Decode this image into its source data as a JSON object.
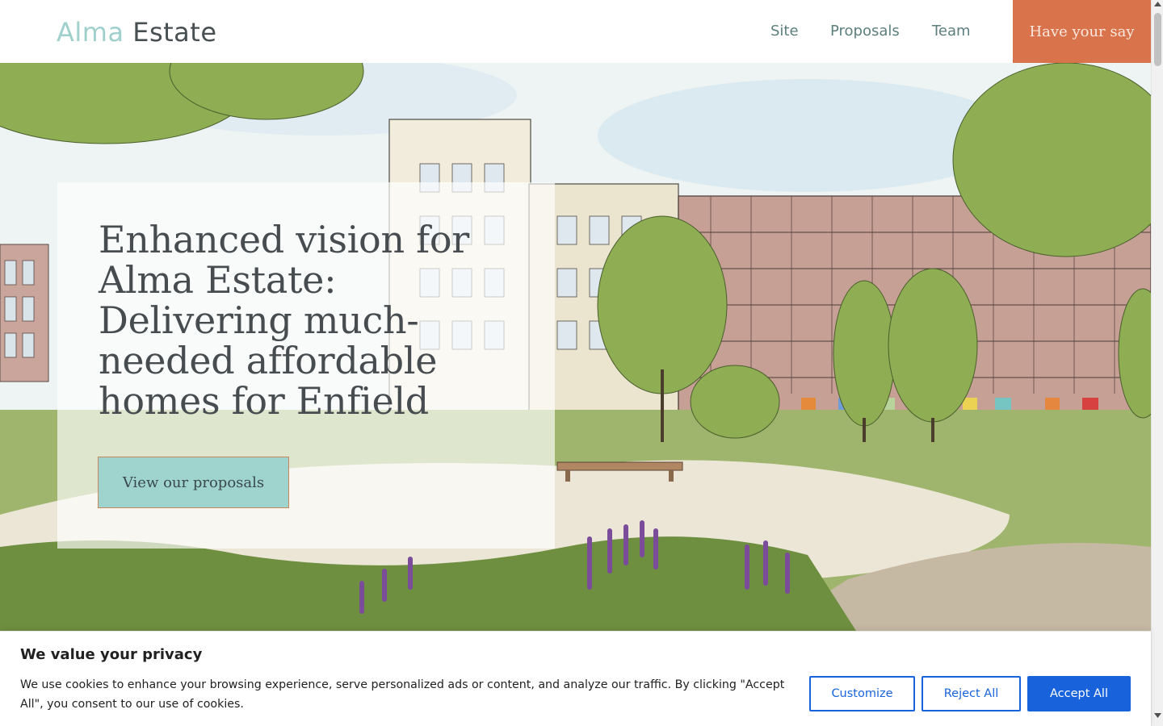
{
  "header": {
    "logo_part1": "Alma",
    "logo_part2": "Estate",
    "nav": [
      {
        "label": "Site"
      },
      {
        "label": "Proposals"
      },
      {
        "label": "Team"
      }
    ],
    "cta_label": "Have your say"
  },
  "hero": {
    "title": "Enhanced vision for Alma Estate: Delivering much-needed affordable homes for Enfield",
    "button_label": "View our proposals"
  },
  "cookie_banner": {
    "title": "We value your privacy",
    "text": "We use cookies to enhance your browsing experience, serve personalized ads or content, and analyze our traffic. By clicking \"Accept All\", you consent to our use of cookies.",
    "customize_label": "Customize",
    "reject_label": "Reject All",
    "accept_label": "Accept All"
  },
  "colors": {
    "logo_accent": "#9fd0cc",
    "cta_orange": "#d8734c",
    "hero_button": "#9fd4ce",
    "cookie_blue": "#1863dc"
  }
}
